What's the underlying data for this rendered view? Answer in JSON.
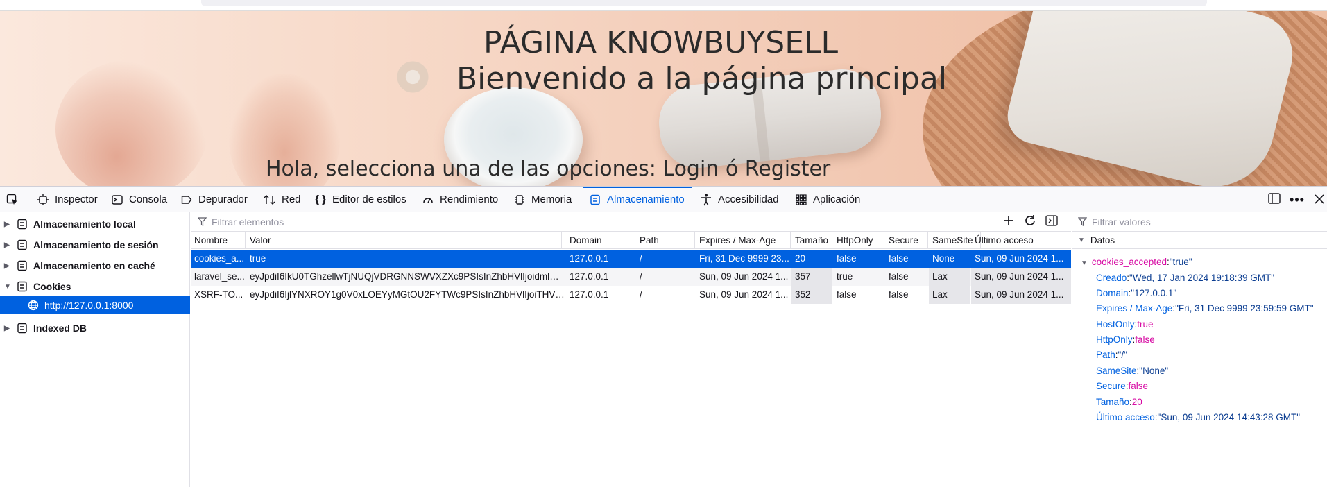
{
  "banner": {
    "title": "PÁGINA KNOWBUYSELL",
    "subtitle": "Bienvenido a la página principal",
    "prompt": "Hola, selecciona una de las opciones: Login ó Register"
  },
  "devtools": {
    "tabs": [
      {
        "label": "Inspector",
        "icon": "inspector-icon"
      },
      {
        "label": "Consola",
        "icon": "console-icon"
      },
      {
        "label": "Depurador",
        "icon": "debugger-icon"
      },
      {
        "label": "Red",
        "icon": "network-icon"
      },
      {
        "label": "Editor de estilos",
        "icon": "style-editor-icon"
      },
      {
        "label": "Rendimiento",
        "icon": "performance-icon"
      },
      {
        "label": "Memoria",
        "icon": "memory-icon"
      },
      {
        "label": "Almacenamiento",
        "icon": "storage-icon",
        "selected": true
      },
      {
        "label": "Accesibilidad",
        "icon": "accessibility-icon"
      },
      {
        "label": "Aplicación",
        "icon": "application-icon"
      }
    ],
    "accent": "#0061e0"
  },
  "sidebar": {
    "items": [
      {
        "label": "Almacenamiento local",
        "expanded": false
      },
      {
        "label": "Almacenamiento de sesión",
        "expanded": false
      },
      {
        "label": "Almacenamiento en caché",
        "expanded": false
      },
      {
        "label": "Cookies",
        "expanded": true
      },
      {
        "label": "http://127.0.0.1:8000",
        "selected": true
      },
      {
        "label": "Indexed DB",
        "expanded": false
      }
    ]
  },
  "table": {
    "filter_placeholder": "Filtrar elementos",
    "columns": [
      "Nombre",
      "Valor",
      "Domain",
      "Path",
      "Expires / Max-Age",
      "Tamaño",
      "HttpOnly",
      "Secure",
      "SameSite",
      "Último acceso"
    ],
    "rows": [
      [
        "cookies_a...",
        "true",
        "127.0.0.1",
        "/",
        "Fri, 31 Dec 9999 23...",
        "20",
        "false",
        "false",
        "None",
        "Sun, 09 Jun 2024 1..."
      ],
      [
        "laravel_se...",
        "eyJpdiI6IkU0TGhzellwTjNUQjVDRGNNSWVXZXc9PSIsInZhbHVlIjoidmlm...",
        "127.0.0.1",
        "/",
        "Sun, 09 Jun 2024 1...",
        "357",
        "true",
        "false",
        "Lax",
        "Sun, 09 Jun 2024 1..."
      ],
      [
        "XSRF-TO...",
        "eyJpdiI6IjlYNXROY1g0V0xLOEYyMGtOU2FYTWc9PSIsInZhbHVlIjoiTHV1...",
        "127.0.0.1",
        "/",
        "Sun, 09 Jun 2024 1...",
        "352",
        "false",
        "false",
        "Lax",
        "Sun, 09 Jun 2024 1..."
      ]
    ]
  },
  "details": {
    "filter_placeholder": "Filtrar valores",
    "section": "Datos",
    "root": {
      "key": "cookies_accepted",
      "value": "\"true\""
    },
    "fields": [
      {
        "key": "Creado",
        "value": "\"Wed, 17 Jan 2024 19:18:39 GMT\""
      },
      {
        "key": "Domain",
        "value": "\"127.0.0.1\""
      },
      {
        "key": "Expires / Max-Age",
        "value": "\"Fri, 31 Dec 9999 23:59:59 GMT\""
      },
      {
        "key": "HostOnly",
        "value": "true",
        "boolean": true
      },
      {
        "key": "HttpOnly",
        "value": "false",
        "boolean": true
      },
      {
        "key": "Path",
        "value": "\"/\""
      },
      {
        "key": "SameSite",
        "value": "\"None\""
      },
      {
        "key": "Secure",
        "value": "false",
        "boolean": true
      },
      {
        "key": "Tamaño",
        "value": "20",
        "boolean": true
      },
      {
        "key": "Último acceso",
        "value": "\"Sun, 09 Jun 2024 14:43:28 GMT\""
      }
    ]
  }
}
